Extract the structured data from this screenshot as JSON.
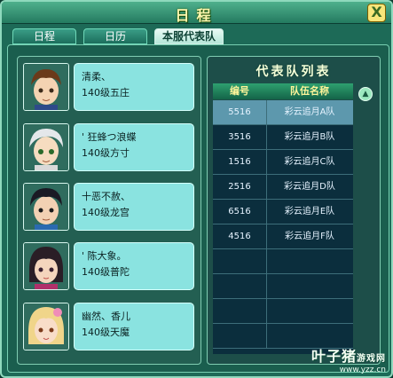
{
  "window": {
    "title": "日程",
    "close_glyph": "X"
  },
  "tabs": [
    {
      "label": "日程",
      "active": false
    },
    {
      "label": "日历",
      "active": false
    },
    {
      "label": "本服代表队",
      "active": true
    }
  ],
  "members": [
    {
      "name": "清柔、",
      "detail": "140级五庄",
      "portrait": "boy-brown-hair-portrait"
    },
    {
      "name": "'  狂蜂つ浪蝶",
      "detail": "140级方寸",
      "portrait": "boy-silver-hair-portrait"
    },
    {
      "name": "十恶不赦、",
      "detail": "140级龙宫",
      "portrait": "boy-black-hair-portrait"
    },
    {
      "name": "'  陈大象。",
      "detail": "140级普陀",
      "portrait": "girl-black-hair-portrait"
    },
    {
      "name": "幽然、香儿",
      "detail": "140级天魔",
      "portrait": "girl-blonde-hair-portrait"
    }
  ],
  "team_list": {
    "title": "代表队列表",
    "headers": {
      "number": "编号",
      "team_name": "队伍名称"
    },
    "rows": [
      {
        "number": "5516",
        "name": "彩云追月A队",
        "selected": true
      },
      {
        "number": "3516",
        "name": "彩云追月B队",
        "selected": false
      },
      {
        "number": "1516",
        "name": "彩云追月C队",
        "selected": false
      },
      {
        "number": "2516",
        "name": "彩云追月D队",
        "selected": false
      },
      {
        "number": "6516",
        "name": "彩云追月E队",
        "selected": false
      },
      {
        "number": "4516",
        "name": "彩云追月F队",
        "selected": false
      }
    ],
    "empty_rows": 4,
    "scroll_up_glyph": "▲"
  },
  "watermark": {
    "brand": "叶子猪",
    "sub": "游戏网",
    "url": "www.yzz.cn"
  },
  "colors": {
    "window_bg": "#1d6a57",
    "list_bg": "#0b2e3d",
    "selected_row": "#5d98ad",
    "info_card": "#8ae3e0"
  }
}
